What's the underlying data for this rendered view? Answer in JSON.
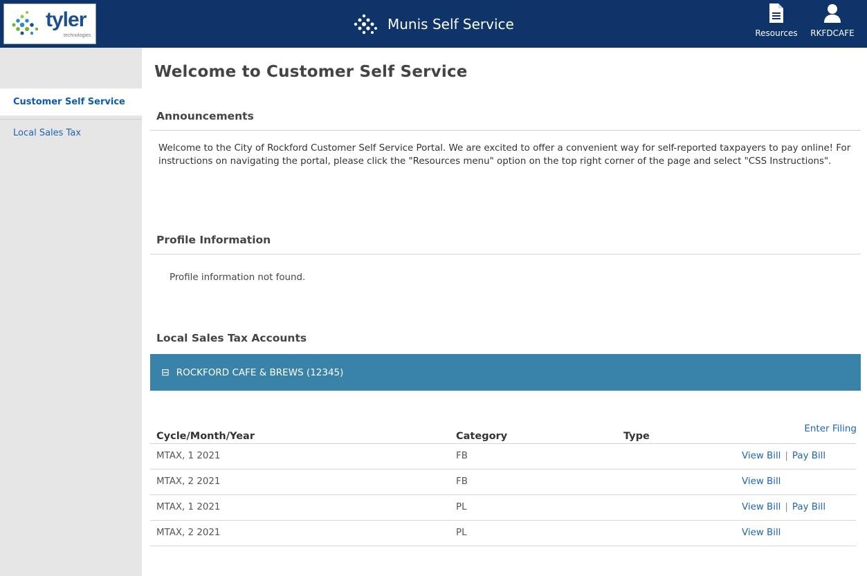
{
  "header": {
    "logo_text": "tyler",
    "logo_sub": "technologies",
    "app_title": "Munis Self Service",
    "resources_label": "Resources",
    "user_label": "RKFDCAFE"
  },
  "sidebar": {
    "items": [
      {
        "label": "Customer Self Service"
      },
      {
        "label": "Local Sales Tax"
      }
    ]
  },
  "main": {
    "title": "Welcome to Customer Self Service",
    "announcements": {
      "heading": "Announcements",
      "text": "Welcome to the City of Rockford Customer Self Service Portal. We are excited to offer a convenient way for self-reported taxpayers to pay online! For instructions on navigating the portal, please click the \"Resources menu\" option on the top right corner of the page and select \"CSS Instructions\"."
    },
    "profile": {
      "heading": "Profile Information",
      "message": "Profile information not found."
    },
    "accounts": {
      "heading": "Local Sales Tax Accounts",
      "collapse_glyph": "⊟",
      "account_name": "ROCKFORD CAFE & BREWS (12345)",
      "enter_filing": "Enter Filing",
      "columns": [
        "Cycle/Month/Year",
        "Category",
        "Type"
      ],
      "rows": [
        {
          "cycle": "MTAX, 1 2021",
          "category": "FB",
          "type": "",
          "view": "View Bill",
          "sep": "|",
          "pay": "Pay Bill"
        },
        {
          "cycle": "MTAX, 2 2021",
          "category": "FB",
          "type": "",
          "view": "View Bill",
          "sep": "",
          "pay": ""
        },
        {
          "cycle": "MTAX, 1 2021",
          "category": "PL",
          "type": "",
          "view": "View Bill",
          "sep": "|",
          "pay": "Pay Bill"
        },
        {
          "cycle": "MTAX, 2 2021",
          "category": "PL",
          "type": "",
          "view": "View Bill",
          "sep": "",
          "pay": ""
        }
      ]
    }
  },
  "colors": {
    "header_bg": "#0e3469",
    "account_bar": "#3a83a8",
    "link": "#1c64b5",
    "sidebar_bg": "#e6e6e6"
  },
  "icons": {
    "logo": "tyler-dots-logo",
    "resources": "document-icon",
    "user": "user-icon"
  }
}
